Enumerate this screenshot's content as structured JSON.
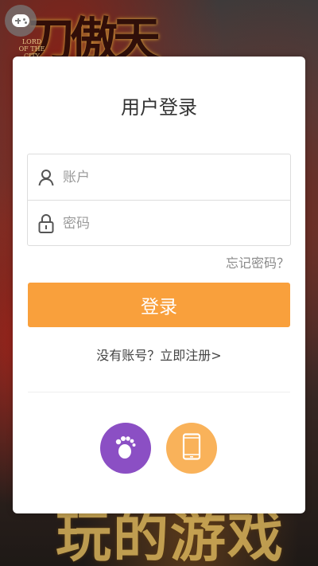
{
  "background": {
    "game_title": "刀傲天",
    "game_subtitle": "LORD OF THE CITY",
    "bottom_art_text": "玩的游戏"
  },
  "login": {
    "title": "用户登录",
    "account_placeholder": "账户",
    "password_placeholder": "密码",
    "forgot_password": "忘记密码？",
    "submit_label": "登录",
    "register_prompt": "没有账号？立即注册>"
  },
  "icons": {
    "floating_button": "gamepad-icon",
    "account": "user-icon",
    "password": "lock-icon",
    "guest_login": "footprint-icon",
    "phone_login": "phone-icon"
  },
  "colors": {
    "accent": "#f9a03c",
    "guest_button": "#8b4fc4",
    "phone_button": "#f9b25a"
  }
}
